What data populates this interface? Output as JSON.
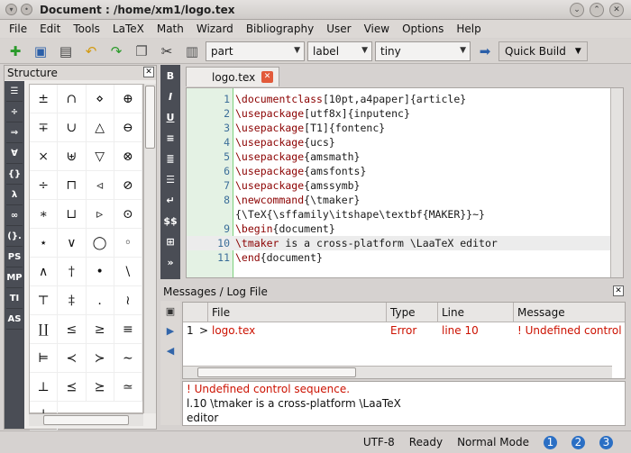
{
  "window": {
    "title": "Document : /home/xm1/logo.tex"
  },
  "menu": [
    "File",
    "Edit",
    "Tools",
    "LaTeX",
    "Math",
    "Wizard",
    "Bibliography",
    "User",
    "View",
    "Options",
    "Help"
  ],
  "toolbar": {
    "combo_part": "part",
    "combo_label": "label",
    "combo_size": "tiny",
    "quick_build": "Quick Build"
  },
  "structure": {
    "title": "Structure",
    "side_tools": [
      "AS",
      "TI",
      "MP",
      "PS"
    ],
    "symbols": [
      "±",
      "∩",
      "⋄",
      "⊕",
      "∓",
      "∪",
      "△",
      "⊖",
      "×",
      "⊎",
      "▽",
      "⊗",
      "÷",
      "⊓",
      "◃",
      "⊘",
      "∗",
      "⊔",
      "▹",
      "⊙",
      "⋆",
      "∨",
      "◯",
      "◦",
      "∧",
      "†",
      "•",
      "\\",
      "⊤",
      "‡",
      ".",
      "≀",
      "∐",
      "≤",
      "≥",
      "≡",
      "⊨",
      "≺",
      "≻",
      "∼",
      "⊥",
      "⪯",
      "⪰",
      "≃",
      "∣"
    ]
  },
  "editor": {
    "tab_label": "logo.tex",
    "format_tools": [
      "B",
      "I",
      "U",
      "$$"
    ],
    "lines": [
      {
        "num": "1",
        "cmd": "\\documentclass",
        "rest": "[10pt,a4paper]{article}"
      },
      {
        "num": "2",
        "cmd": "\\usepackage",
        "rest": "[utf8x]{inputenc}"
      },
      {
        "num": "3",
        "cmd": "\\usepackage",
        "rest": "[T1]{fontenc}"
      },
      {
        "num": "4",
        "cmd": "\\usepackage",
        "rest": "{ucs}"
      },
      {
        "num": "5",
        "cmd": "\\usepackage",
        "rest": "{amsmath}"
      },
      {
        "num": "6",
        "cmd": "\\usepackage",
        "rest": "{amsfonts}"
      },
      {
        "num": "7",
        "cmd": "\\usepackage",
        "rest": "{amssymb}"
      },
      {
        "num": "8",
        "cmd": "\\newcommand",
        "rest": "{\\tmaker}"
      },
      {
        "num": "",
        "cmd": "",
        "rest": "{\\TeX{\\sffamily\\itshape\\textbf{MAKER}}~}"
      },
      {
        "num": "9",
        "cmd": "\\begin",
        "rest": "{document}"
      },
      {
        "num": "10",
        "cmd": "\\tmaker",
        "rest": " is a cross-platform \\LaaTeX editor"
      },
      {
        "num": "11",
        "cmd": "\\end",
        "rest": "{document}"
      }
    ]
  },
  "messages": {
    "title": "Messages / Log File",
    "columns": [
      "File",
      "Type",
      "Line",
      "Message"
    ],
    "row": {
      "index": "1",
      "marker": ">",
      "file": "logo.tex",
      "type": "Error",
      "line": "line 10",
      "message": "! Undefined control se"
    },
    "log": [
      "! Undefined control sequence.",
      "l.10 \\tmaker is a cross-platform \\LaaTeX",
      "editor"
    ]
  },
  "status": {
    "encoding": "UTF-8",
    "state": "Ready",
    "mode": "Normal Mode",
    "view1": "1",
    "view2": "2",
    "view3": "3"
  }
}
